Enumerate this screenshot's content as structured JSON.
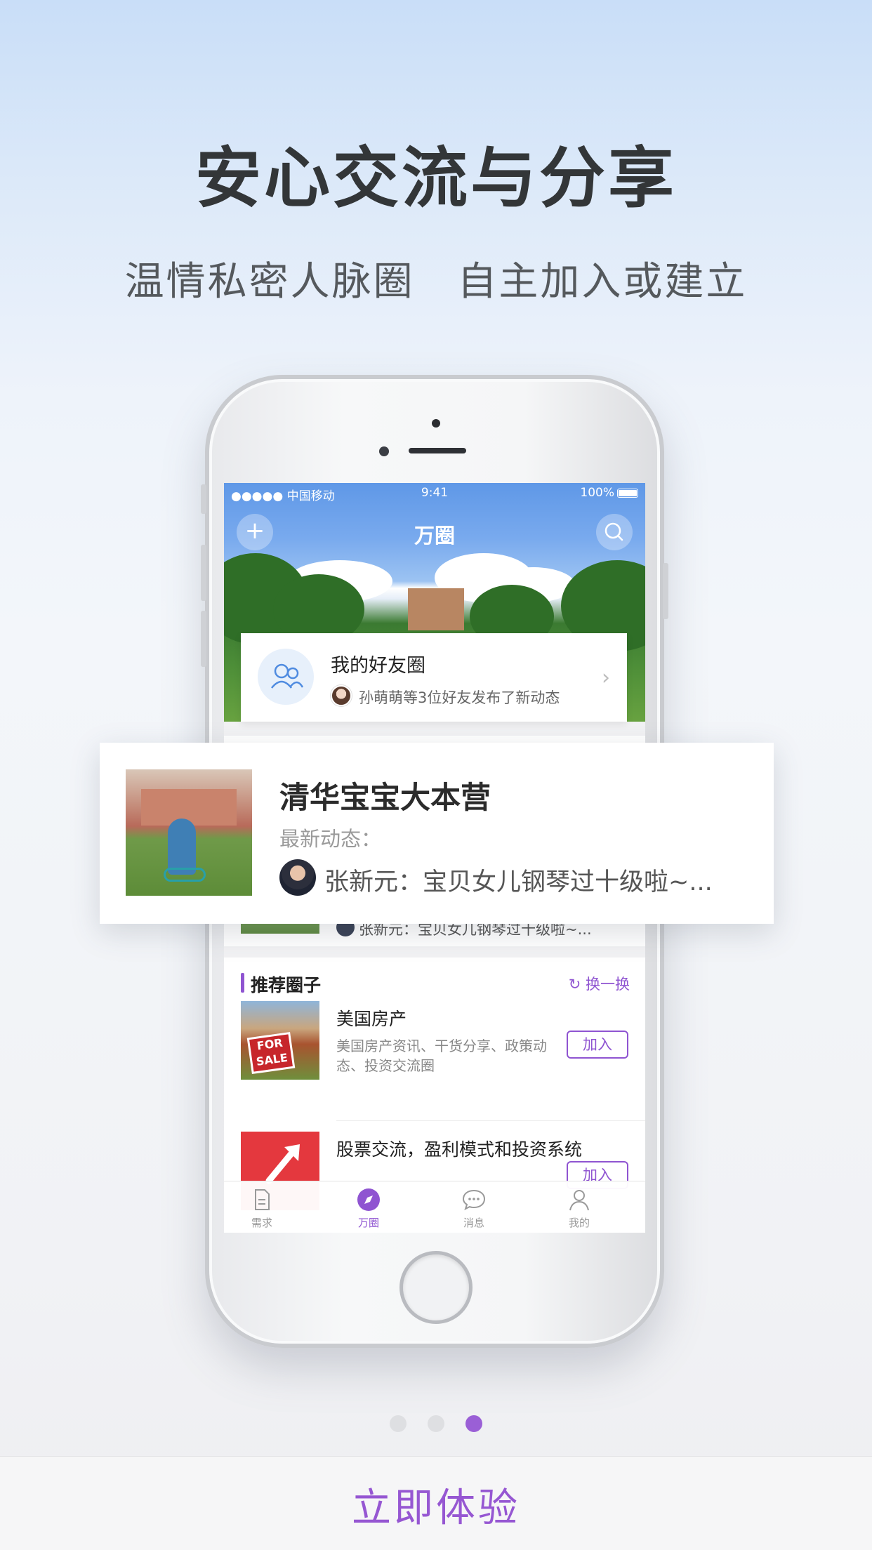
{
  "headline": "安心交流与分享",
  "subline": "温情私密人脉圈 自主加入或建立",
  "status_bar": {
    "carrier": "●●●●● 中国移动",
    "time": "9:41",
    "battery": "100%"
  },
  "nav": {
    "title": "万圈",
    "add_icon": "plus-icon",
    "search_icon": "search-icon"
  },
  "friend_circle": {
    "title": "我的好友圈",
    "subtitle": "孙萌萌等3位好友发布了新动态"
  },
  "featured_circle": {
    "name": "清华宝宝大本营",
    "latest_label": "最新动态：",
    "latest_post": "张新元：宝贝女儿钢琴过十级啦~...",
    "background_post": "张新元：宝贝女儿钢琴过十级啦~..."
  },
  "recommended": {
    "title": "推荐圈子",
    "refresh_label": "换一换",
    "items": [
      {
        "title": "美国房产",
        "desc": "美国房产资讯、干货分享、政策动态、投资交流圈",
        "join": "加入"
      },
      {
        "title": "股票交流，盈利模式和投资系统",
        "join": "加入"
      }
    ]
  },
  "tabs": [
    {
      "label": "需求",
      "icon": "document-icon"
    },
    {
      "label": "万圈",
      "icon": "compass-icon"
    },
    {
      "label": "消息",
      "icon": "chat-bubble-icon"
    },
    {
      "label": "我的",
      "icon": "person-icon"
    }
  ],
  "pagination": {
    "count": 3,
    "active": 3
  },
  "cta_label": "立即体验",
  "colors": {
    "accent": "#9657d2",
    "headline": "#333638",
    "sky": "#5f98e7"
  }
}
